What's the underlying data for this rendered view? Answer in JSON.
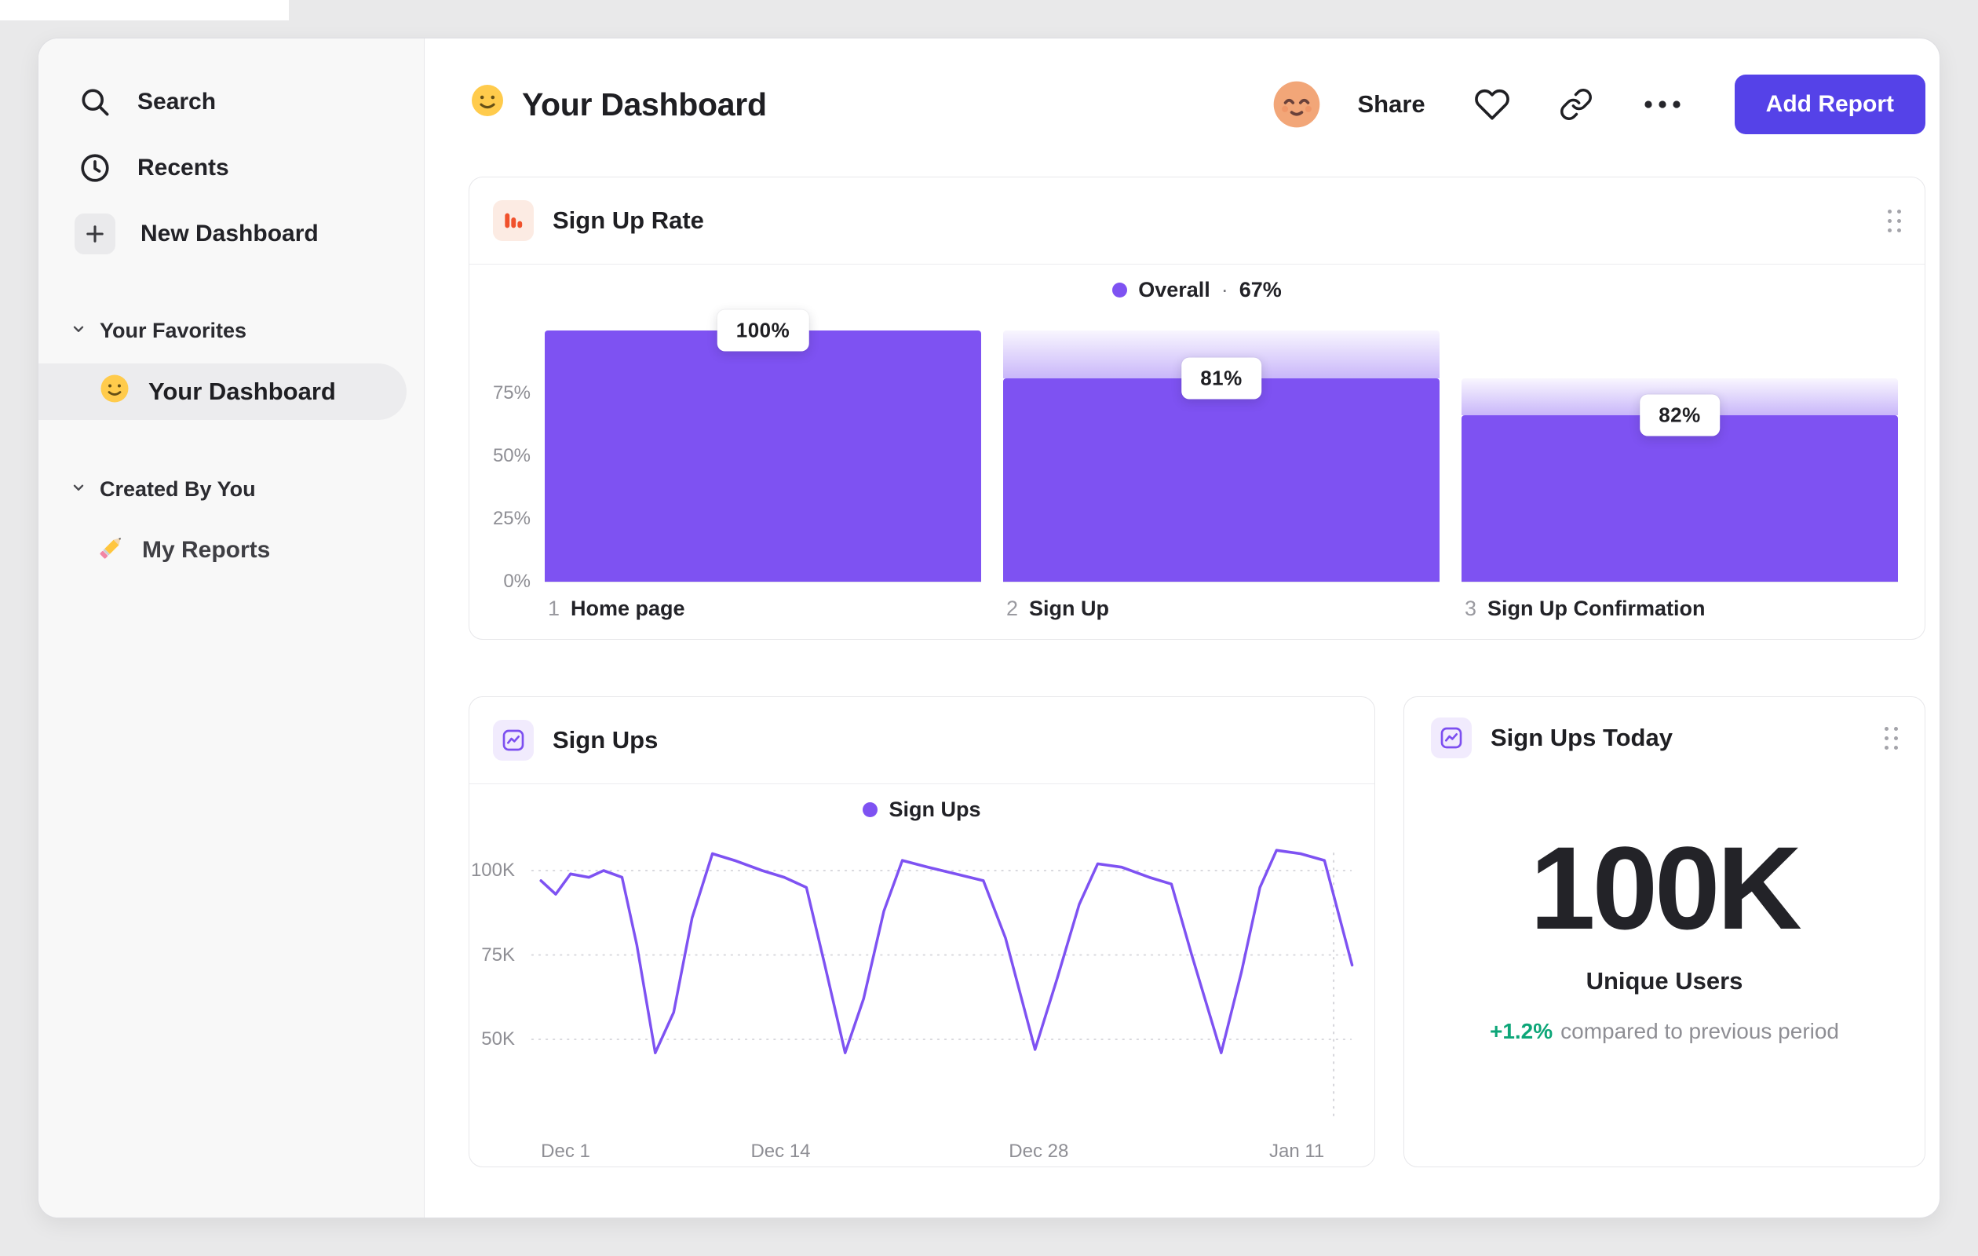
{
  "window": {
    "background": "#E9E9EA"
  },
  "colors": {
    "accent_purple": "#7E52F2",
    "button_purple": "#5542E8",
    "positive_green": "#0DA678",
    "funnel_icon_orange": "#F0512C",
    "text_dark": "#1F1F23",
    "text_gray": "#8E8E94"
  },
  "sidebar": {
    "nav": [
      {
        "label": "Search",
        "icon": "search-icon"
      },
      {
        "label": "Recents",
        "icon": "clock-icon"
      },
      {
        "label": "New Dashboard",
        "icon": "plus-icon"
      }
    ],
    "sections": [
      {
        "title": "Your Favorites",
        "items": [
          {
            "label": "Your Dashboard",
            "icon": "smiley-icon",
            "selected": true
          }
        ]
      },
      {
        "title": "Created By You",
        "items": [
          {
            "label": "My Reports",
            "icon": "pencil-icon",
            "selected": false
          }
        ]
      }
    ]
  },
  "header": {
    "title": "Your Dashboard",
    "share": "Share",
    "add_report": "Add Report"
  },
  "cards": {
    "funnel": {
      "title": "Sign Up Rate",
      "legend_label": "Overall",
      "legend_sep": "·",
      "legend_value": "67%"
    },
    "line": {
      "title": "Sign Ups",
      "legend_label": "Sign Ups"
    },
    "kpi": {
      "title": "Sign Ups Today",
      "value": "100K",
      "sublabel": "Unique Users",
      "delta": "+1.2%",
      "delta_note": "compared to previous period"
    }
  },
  "chart_data": [
    {
      "type": "bar",
      "variant": "funnel",
      "title": "Sign Up Rate",
      "legend": "Overall · 67%",
      "overall_conversion_pct": 67,
      "steps": [
        {
          "index": 1,
          "label": "Home page",
          "step_conversion_pct": 100,
          "overall_pct": 100
        },
        {
          "index": 2,
          "label": "Sign Up",
          "step_conversion_pct": 81,
          "overall_pct": 81
        },
        {
          "index": 3,
          "label": "Sign Up Confirmation",
          "step_conversion_pct": 82,
          "overall_pct": 66.4
        }
      ],
      "y_ticks": [
        {
          "pct": 75,
          "label": "75%"
        },
        {
          "pct": 50,
          "label": "50%"
        },
        {
          "pct": 25,
          "label": "25%"
        },
        {
          "pct": 0,
          "label": "0%"
        }
      ],
      "ylim": [
        0,
        100
      ]
    },
    {
      "type": "line",
      "title": "Sign Ups",
      "series": [
        {
          "name": "Sign Ups",
          "unit": "thousands",
          "points": [
            [
              0,
              97
            ],
            [
              0.8,
              93
            ],
            [
              1.6,
              99
            ],
            [
              2.6,
              98
            ],
            [
              3.4,
              100
            ],
            [
              4.4,
              98
            ],
            [
              5.2,
              78
            ],
            [
              6.2,
              46
            ],
            [
              7.2,
              58
            ],
            [
              8.2,
              86
            ],
            [
              9.3,
              105
            ],
            [
              10.5,
              103
            ],
            [
              12,
              100
            ],
            [
              13.2,
              98
            ],
            [
              14.4,
              95
            ],
            [
              15.4,
              72
            ],
            [
              16.5,
              46
            ],
            [
              17.5,
              62
            ],
            [
              18.6,
              88
            ],
            [
              19.6,
              103
            ],
            [
              21,
              101
            ],
            [
              22.5,
              99
            ],
            [
              24,
              97
            ],
            [
              25.2,
              80
            ],
            [
              26.8,
              47
            ],
            [
              28,
              68
            ],
            [
              29.2,
              90
            ],
            [
              30.2,
              102
            ],
            [
              31.5,
              101
            ],
            [
              33,
              98
            ],
            [
              34.2,
              96
            ],
            [
              35.3,
              75
            ],
            [
              36.9,
              46
            ],
            [
              38,
              70
            ],
            [
              39,
              95
            ],
            [
              39.9,
              106
            ],
            [
              41.2,
              105
            ],
            [
              42.5,
              103
            ],
            [
              44,
              72
            ]
          ]
        }
      ],
      "x_ticks": [
        {
          "day": 0,
          "label": "Dec 1"
        },
        {
          "day": 13,
          "label": "Dec 14"
        },
        {
          "day": 27,
          "label": "Dec 28"
        },
        {
          "day": 41,
          "label": "Jan 11"
        }
      ],
      "y_ticks": [
        {
          "value": 100,
          "label": "100K"
        },
        {
          "value": 75,
          "label": "75K"
        },
        {
          "value": 50,
          "label": "50K"
        }
      ],
      "ylim_thousands": [
        40,
        110
      ],
      "marker_day": 43,
      "grid": "dotted-horizontal",
      "legend_position": "top-center"
    }
  ]
}
